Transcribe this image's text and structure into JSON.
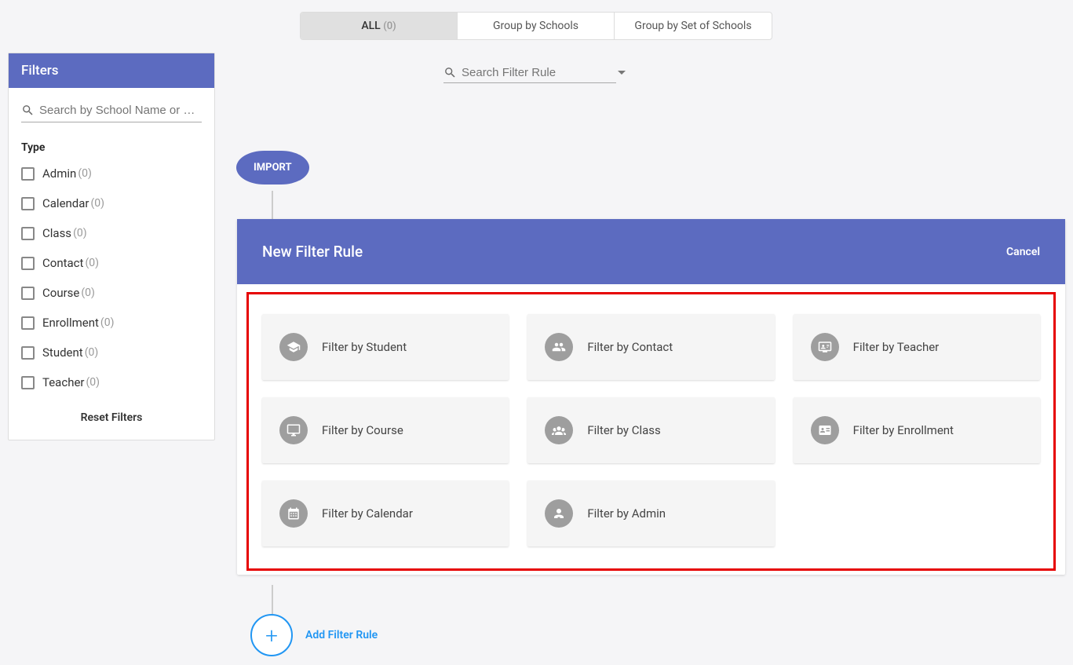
{
  "tabs": [
    {
      "label": "ALL",
      "count": "(0)"
    },
    {
      "label": "Group by Schools"
    },
    {
      "label": "Group by Set of Schools"
    }
  ],
  "search_rule": {
    "placeholder": "Search Filter Rule"
  },
  "sidebar": {
    "title": "Filters",
    "search_placeholder": "Search by School Name or …",
    "type_label": "Type",
    "items": [
      {
        "label": "Admin",
        "count": "(0)"
      },
      {
        "label": "Calendar",
        "count": "(0)"
      },
      {
        "label": "Class",
        "count": "(0)"
      },
      {
        "label": "Contact",
        "count": "(0)"
      },
      {
        "label": "Course",
        "count": "(0)"
      },
      {
        "label": "Enrollment",
        "count": "(0)"
      },
      {
        "label": "Student",
        "count": "(0)"
      },
      {
        "label": "Teacher",
        "count": "(0)"
      }
    ],
    "reset_label": "Reset Filters"
  },
  "import_label": "IMPORT",
  "rule_card": {
    "title": "New Filter Rule",
    "cancel": "Cancel",
    "tiles": [
      "Filter by Student",
      "Filter by Contact",
      "Filter by Teacher",
      "Filter by Course",
      "Filter by Class",
      "Filter by Enrollment",
      "Filter by Calendar",
      "Filter by Admin"
    ]
  },
  "add_rule_label": "Add Filter Rule"
}
